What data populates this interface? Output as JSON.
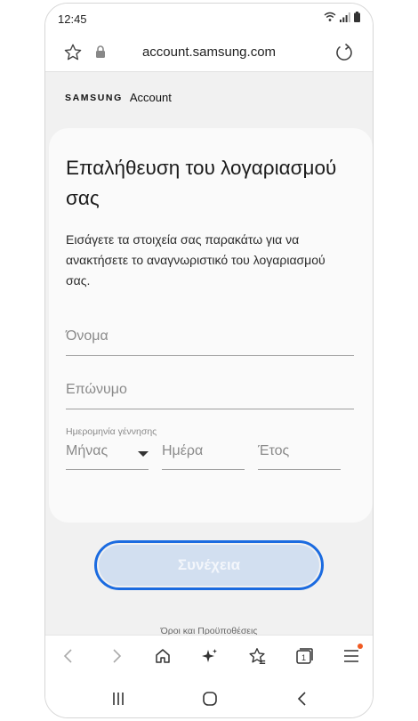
{
  "status_bar": {
    "time": "12:45"
  },
  "browser": {
    "url": "account.samsung.com"
  },
  "brand": {
    "name": "SAMSUNG",
    "product": "Account"
  },
  "card": {
    "title": "Επαλήθευση του λογαριασμού σας",
    "description": "Εισάγετε τα στοιχεία σας παρακάτω για να ανακτήσετε το αναγνωριστικό του λογαριασμού σας.",
    "first_name_placeholder": "Όνομα",
    "last_name_placeholder": "Επώνυμο",
    "dob_label": "Ημερομηνία γέννησης",
    "month_placeholder": "Μήνας",
    "day_placeholder": "Ημέρα",
    "year_placeholder": "Έτος"
  },
  "continue_label": "Συνέχεια",
  "terms_label": "Όροι και Προϋποθέσεις",
  "toolbar": {
    "tab_count": "1",
    "icons": [
      "back-icon",
      "forward-icon",
      "home-icon",
      "sparkle-icon",
      "bookmark-star-icon",
      "tabs-icon",
      "menu-icon"
    ]
  },
  "colors": {
    "accent": "#1b6be0",
    "button_fill": "#d2dff0",
    "notification_dot": "#f05a22"
  }
}
